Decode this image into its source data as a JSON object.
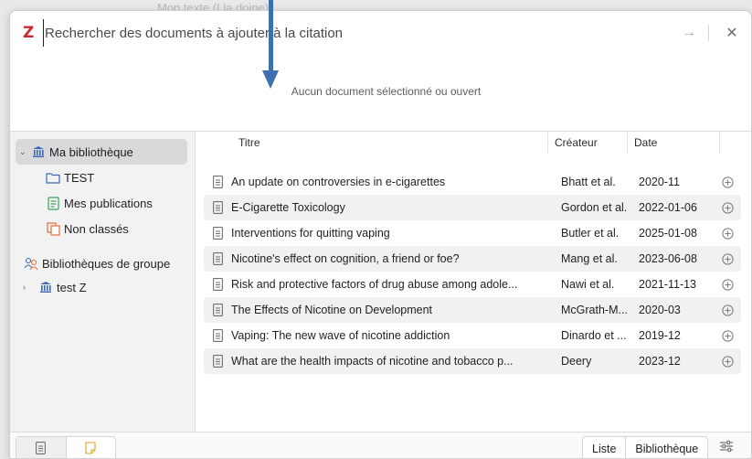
{
  "background_text": "Mon texte (I la doine)",
  "search": {
    "placeholder": "Rechercher des documents à ajouter à la citation",
    "accept_symbol": "→",
    "close_symbol": "✕"
  },
  "preview": {
    "empty_message": "Aucun document sélectionné ou ouvert"
  },
  "sidebar": {
    "items": [
      {
        "label": "Ma bibliothèque",
        "icon": "library-icon",
        "expanded": true,
        "selected": true
      },
      {
        "label": "TEST",
        "icon": "folder-icon"
      },
      {
        "label": "Mes publications",
        "icon": "publications-icon"
      },
      {
        "label": "Non classés",
        "icon": "unfiled-icon"
      },
      {
        "label": "Bibliothèques de groupe",
        "icon": "group-icon"
      },
      {
        "label": "test Z",
        "icon": "library-icon",
        "expanded": false
      }
    ]
  },
  "table": {
    "columns": [
      "Titre",
      "Créateur",
      "Date"
    ],
    "rows": [
      {
        "title": "An update on controversies in e-cigarettes",
        "creator": "Bhatt et al.",
        "date": "2020-11"
      },
      {
        "title": "E-Cigarette Toxicology",
        "creator": "Gordon et al.",
        "date": "2022-01-06"
      },
      {
        "title": "Interventions for quitting vaping",
        "creator": "Butler et al.",
        "date": "2025-01-08"
      },
      {
        "title": "Nicotine's effect on cognition, a friend or foe?",
        "creator": "Mang et al.",
        "date": "2023-06-08"
      },
      {
        "title": "Risk and protective factors of drug abuse among adole...",
        "creator": "Nawi et al.",
        "date": "2021-11-13"
      },
      {
        "title": "The Effects of Nicotine on Development",
        "creator": "McGrath-M...",
        "date": "2020-03"
      },
      {
        "title": "Vaping: The new wave of nicotine addiction",
        "creator": "Dinardo et ...",
        "date": "2019-12"
      },
      {
        "title": "What are the health impacts of nicotine and tobacco p...",
        "creator": "Deery",
        "date": "2023-12"
      }
    ]
  },
  "footer": {
    "view_list": "Liste",
    "view_library": "Bibliothèque"
  },
  "colors": {
    "accent_red": "#cc2936",
    "library_blue": "#3b6bb5",
    "folder_blue": "#3b6bb5",
    "publications_green": "#3da35d",
    "unfiled_orange": "#e0703a",
    "arrow_blue": "#3e6fb0"
  }
}
